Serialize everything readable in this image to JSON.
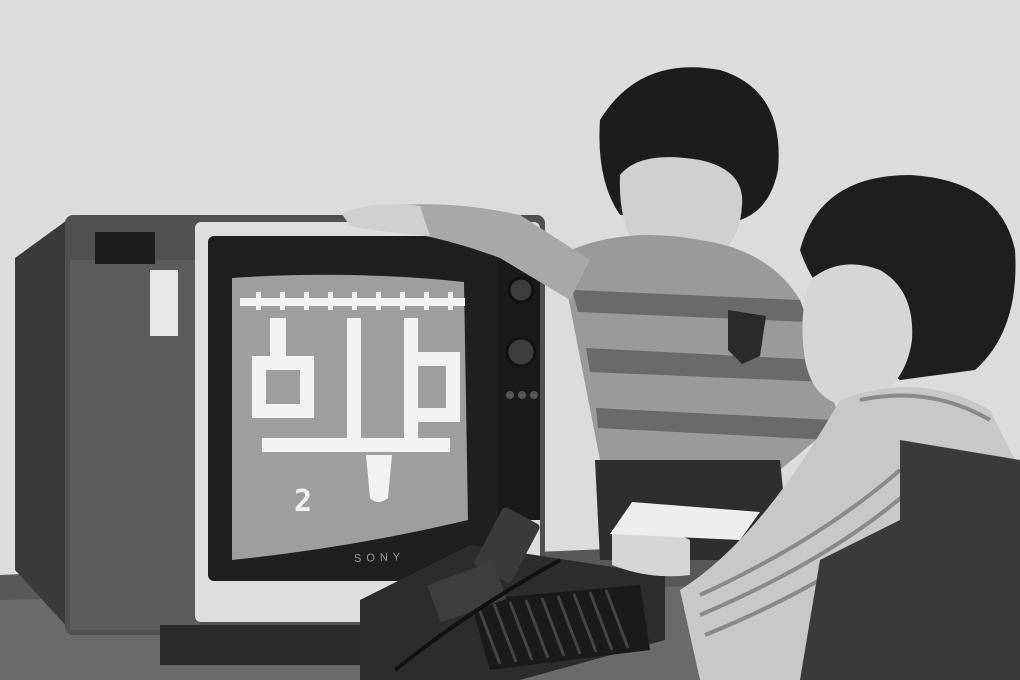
{
  "photo": {
    "tone": "black-and-white",
    "colors": {
      "wall": "#dcdcdc",
      "tv_wood": "#4a4a4a",
      "screen": "#9c9c9c",
      "screen_graphics": "#f2f2f2",
      "console": "#2a2a2a"
    }
  },
  "tv": {
    "brand_text": "SONY",
    "game_score": "2"
  }
}
